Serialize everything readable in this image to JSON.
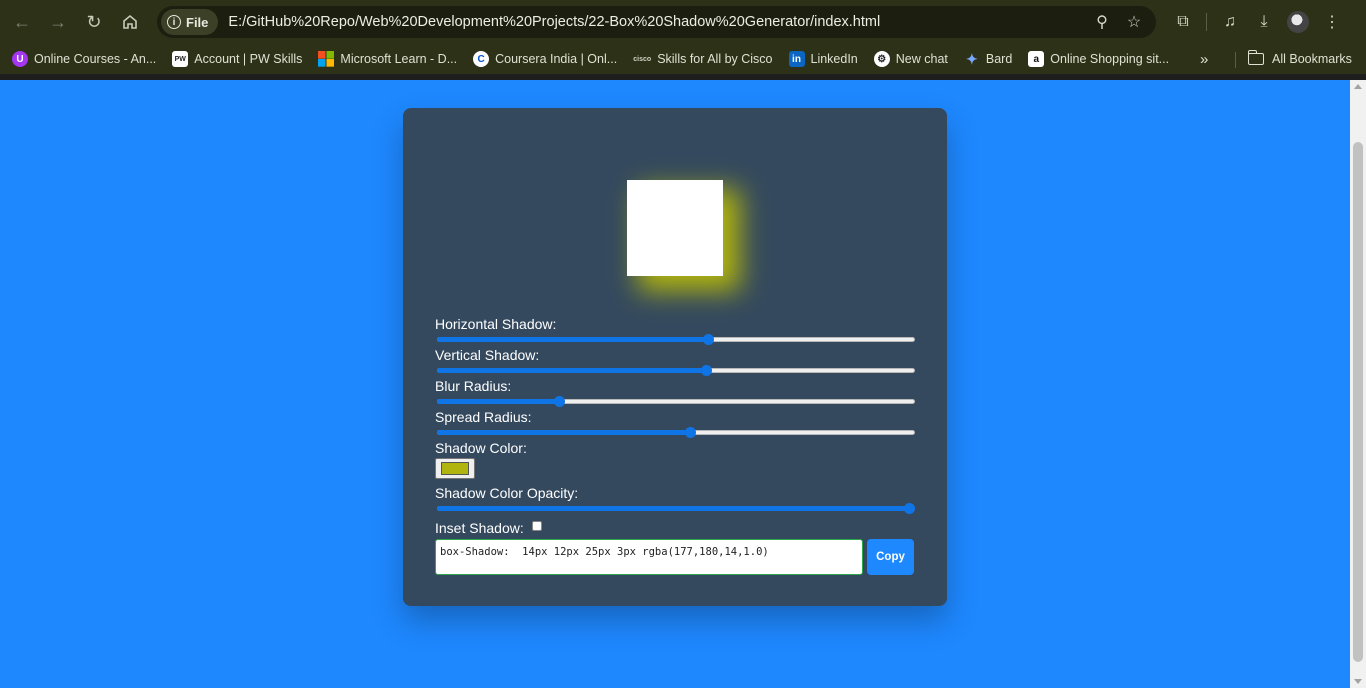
{
  "browser": {
    "site_chip": "File",
    "url": "E:/GitHub%20Repo/Web%20Development%20Projects/22-Box%20Shadow%20Generator/index.html",
    "bookmarks": [
      {
        "label": "Online Courses - An...",
        "icon": "udemy-icon",
        "glyph": "U"
      },
      {
        "label": "Account | PW Skills",
        "icon": "pw-skills-icon",
        "glyph": "PW"
      },
      {
        "label": "Microsoft Learn - D...",
        "icon": "microsoft-icon",
        "glyph": ""
      },
      {
        "label": "Coursera India | Onl...",
        "icon": "coursera-icon",
        "glyph": "C"
      },
      {
        "label": "Skills for All by Cisco",
        "icon": "cisco-icon",
        "glyph": "cisco"
      },
      {
        "label": "LinkedIn",
        "icon": "linkedin-icon",
        "glyph": "in"
      },
      {
        "label": "New chat",
        "icon": "chatgpt-icon",
        "glyph": "⚙"
      },
      {
        "label": "Bard",
        "icon": "bard-icon",
        "glyph": "✦"
      },
      {
        "label": "Online Shopping sit...",
        "icon": "amazon-icon",
        "glyph": "a"
      }
    ],
    "all_bookmarks": "All Bookmarks"
  },
  "page": {
    "background": "#1e88ff",
    "card_color": "#34495e",
    "controls": {
      "horizontal_label": "Horizontal Shadow:",
      "horizontal_pct": 0.57,
      "vertical_label": "Vertical Shadow:",
      "vertical_pct": 0.565,
      "blur_label": "Blur Radius:",
      "blur_pct": 0.25,
      "spread_label": "Spread Radius:",
      "spread_pct": 0.53,
      "color_label": "Shadow Color:",
      "color_value": "#b1b40e",
      "opacity_label": "Shadow Color Opacity:",
      "opacity_pct": 1.0,
      "inset_label": "Inset Shadow:",
      "inset_checked": false
    },
    "output": "box-Shadow:  14px 12px 25px 3px rgba(177,180,14,1.0)",
    "copy_label": "Copy"
  }
}
